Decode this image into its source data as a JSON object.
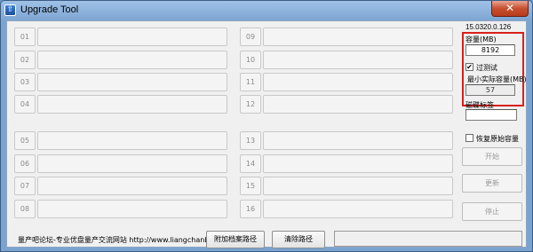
{
  "window": {
    "title": "Upgrade Tool",
    "close_glyph": "✕",
    "app_icon_glyph": "⇧"
  },
  "version": "15.0320.0.126",
  "ports_left": [
    {
      "id": "01"
    },
    {
      "id": "02"
    },
    {
      "id": "03"
    },
    {
      "id": "04"
    },
    {
      "id": "05"
    },
    {
      "id": "06"
    },
    {
      "id": "07"
    },
    {
      "id": "08"
    }
  ],
  "ports_right": [
    {
      "id": "09"
    },
    {
      "id": "10"
    },
    {
      "id": "11"
    },
    {
      "id": "12"
    },
    {
      "id": "13"
    },
    {
      "id": "14"
    },
    {
      "id": "15"
    },
    {
      "id": "16"
    }
  ],
  "capacity": {
    "label": "容量(MB)",
    "value": "8192"
  },
  "test": {
    "checkbox_label": "过测试",
    "checked": true,
    "min_label": "最小实际容量(MB)",
    "min_value": "57"
  },
  "disk_label": {
    "label": "磁碟标签",
    "value": ""
  },
  "restore": {
    "checkbox_label": "恢复原始容量",
    "checked": false
  },
  "buttons": {
    "start": "开始",
    "update": "更新",
    "stop": "停止"
  },
  "footer": {
    "text": "量产吧论坛-专业优盘量产交流网站 http://www.liangchanba.com/",
    "attach_path": "附加档案路径",
    "clear_path": "清除路径"
  }
}
